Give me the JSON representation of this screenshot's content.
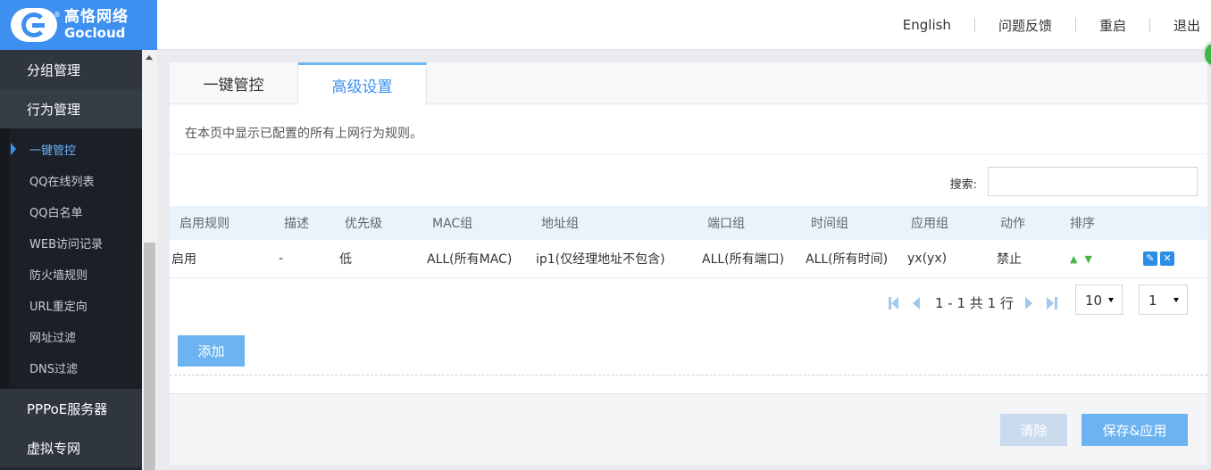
{
  "brand": {
    "cn": "高恪网络",
    "en": "Gocloud",
    "reg": "®"
  },
  "top_nav": [
    "English",
    "问题反馈",
    "重启",
    "退出"
  ],
  "sidebar": {
    "groups": [
      {
        "label": "分组管理"
      },
      {
        "label": "行为管理"
      }
    ],
    "items": [
      {
        "label": "一键管控",
        "active": true
      },
      {
        "label": "QQ在线列表"
      },
      {
        "label": "QQ白名单"
      },
      {
        "label": "WEB访问记录"
      },
      {
        "label": "防火墙规则"
      },
      {
        "label": "URL重定向"
      },
      {
        "label": "网址过滤"
      },
      {
        "label": "DNS过滤"
      }
    ],
    "bottom_groups": [
      {
        "label": "PPPoE服务器"
      },
      {
        "label": "虚拟专网"
      }
    ]
  },
  "tabs": [
    {
      "label": "一键管控",
      "active": false
    },
    {
      "label": "高级设置",
      "active": true
    }
  ],
  "description": "在本页中显示已配置的所有上网行为规则。",
  "search": {
    "label": "搜索:",
    "value": ""
  },
  "table": {
    "headers": [
      "启用规则",
      "描述",
      "优先级",
      "MAC组",
      "地址组",
      "端口组",
      "时间组",
      "应用组",
      "动作",
      "排序",
      ""
    ],
    "rows": [
      [
        "启用",
        "-",
        "低",
        "ALL(所有MAC)",
        "ip1(仅经理地址不包含)",
        "ALL(所有端口)",
        "ALL(所有时间)",
        "yx(yx)",
        "禁止"
      ]
    ]
  },
  "pager": {
    "text": "1 - 1 共 1 行",
    "page_size": "10",
    "page": "1"
  },
  "buttons": {
    "add": "添加",
    "clear": "清除",
    "save": "保存&应用"
  },
  "colors": {
    "brand": "#3d8ff0",
    "sidebar_bg": "#24292f",
    "button": "#6cb4f0",
    "table_header": "#e8f3fc"
  }
}
